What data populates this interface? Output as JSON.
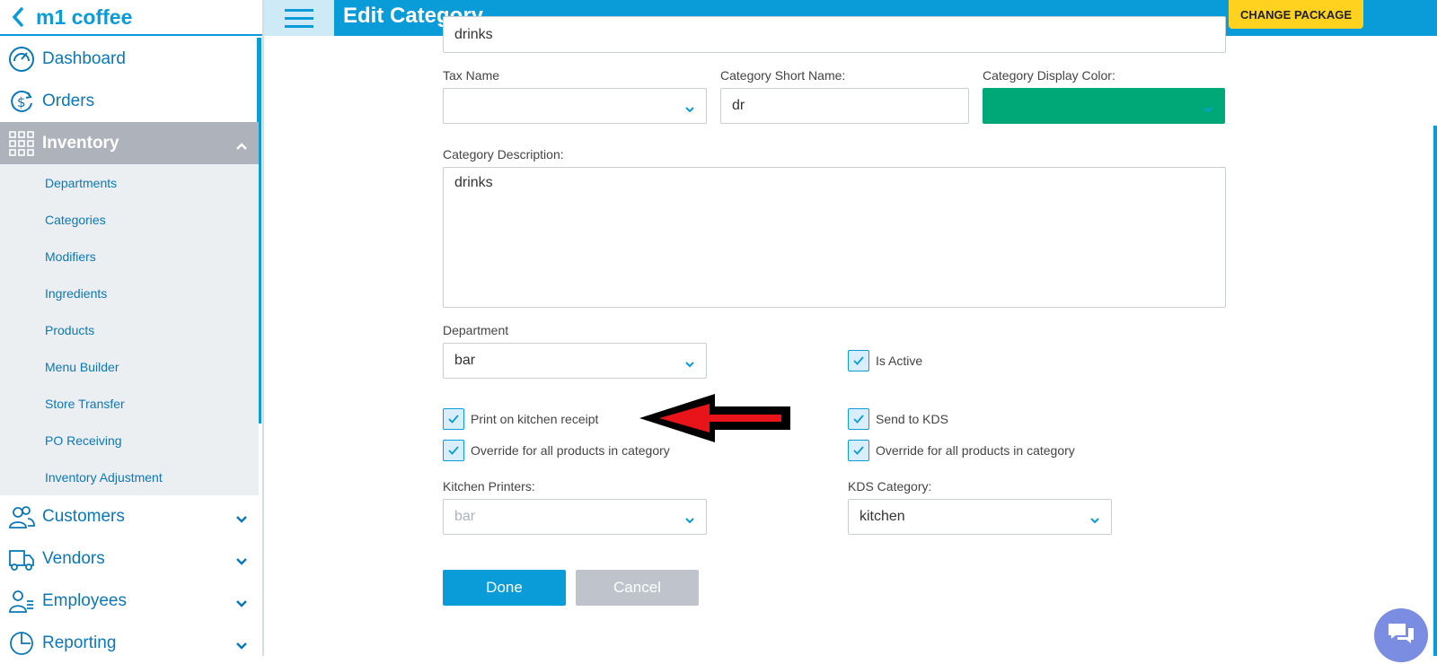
{
  "store_name": "m1 coffee",
  "page_title": "Edit Category",
  "change_package": "CHANGE PACKAGE",
  "sidebar": {
    "items": [
      {
        "label": "Dashboard"
      },
      {
        "label": "Orders"
      },
      {
        "label": "Inventory"
      }
    ],
    "inventory_sub": [
      "Departments",
      "Categories",
      "Modifiers",
      "Ingredients",
      "Products",
      "Menu Builder",
      "Store Transfer",
      "PO Receiving",
      "Inventory Adjustment"
    ],
    "lower": [
      {
        "label": "Customers"
      },
      {
        "label": "Vendors"
      },
      {
        "label": "Employees"
      },
      {
        "label": "Reporting"
      }
    ]
  },
  "form": {
    "category_name_value": "drinks",
    "tax_name_label": "Tax Name",
    "tax_name_value": "",
    "short_name_label": "Category Short Name:",
    "short_name_value": "dr",
    "display_color_label": "Category Display Color:",
    "display_color": "#00a878",
    "description_label": "Category Description:",
    "description_value": "drinks",
    "department_label": "Department",
    "department_value": "bar",
    "is_active_label": "Is Active",
    "print_kitchen_label": "Print on kitchen receipt",
    "override_left_label": "Override for all products in category",
    "send_kds_label": "Send to KDS",
    "override_right_label": "Override for all products in category",
    "kitchen_printers_label": "Kitchen Printers:",
    "kitchen_printers_placeholder": "bar",
    "kds_category_label": "KDS Category:",
    "kds_category_value": "kitchen",
    "done_label": "Done",
    "cancel_label": "Cancel"
  },
  "colors": {
    "accent": "#0a9bd9",
    "active_nav": "#adb2bb",
    "cancel": "#bfc3cb",
    "badge": "#ffd21f"
  }
}
